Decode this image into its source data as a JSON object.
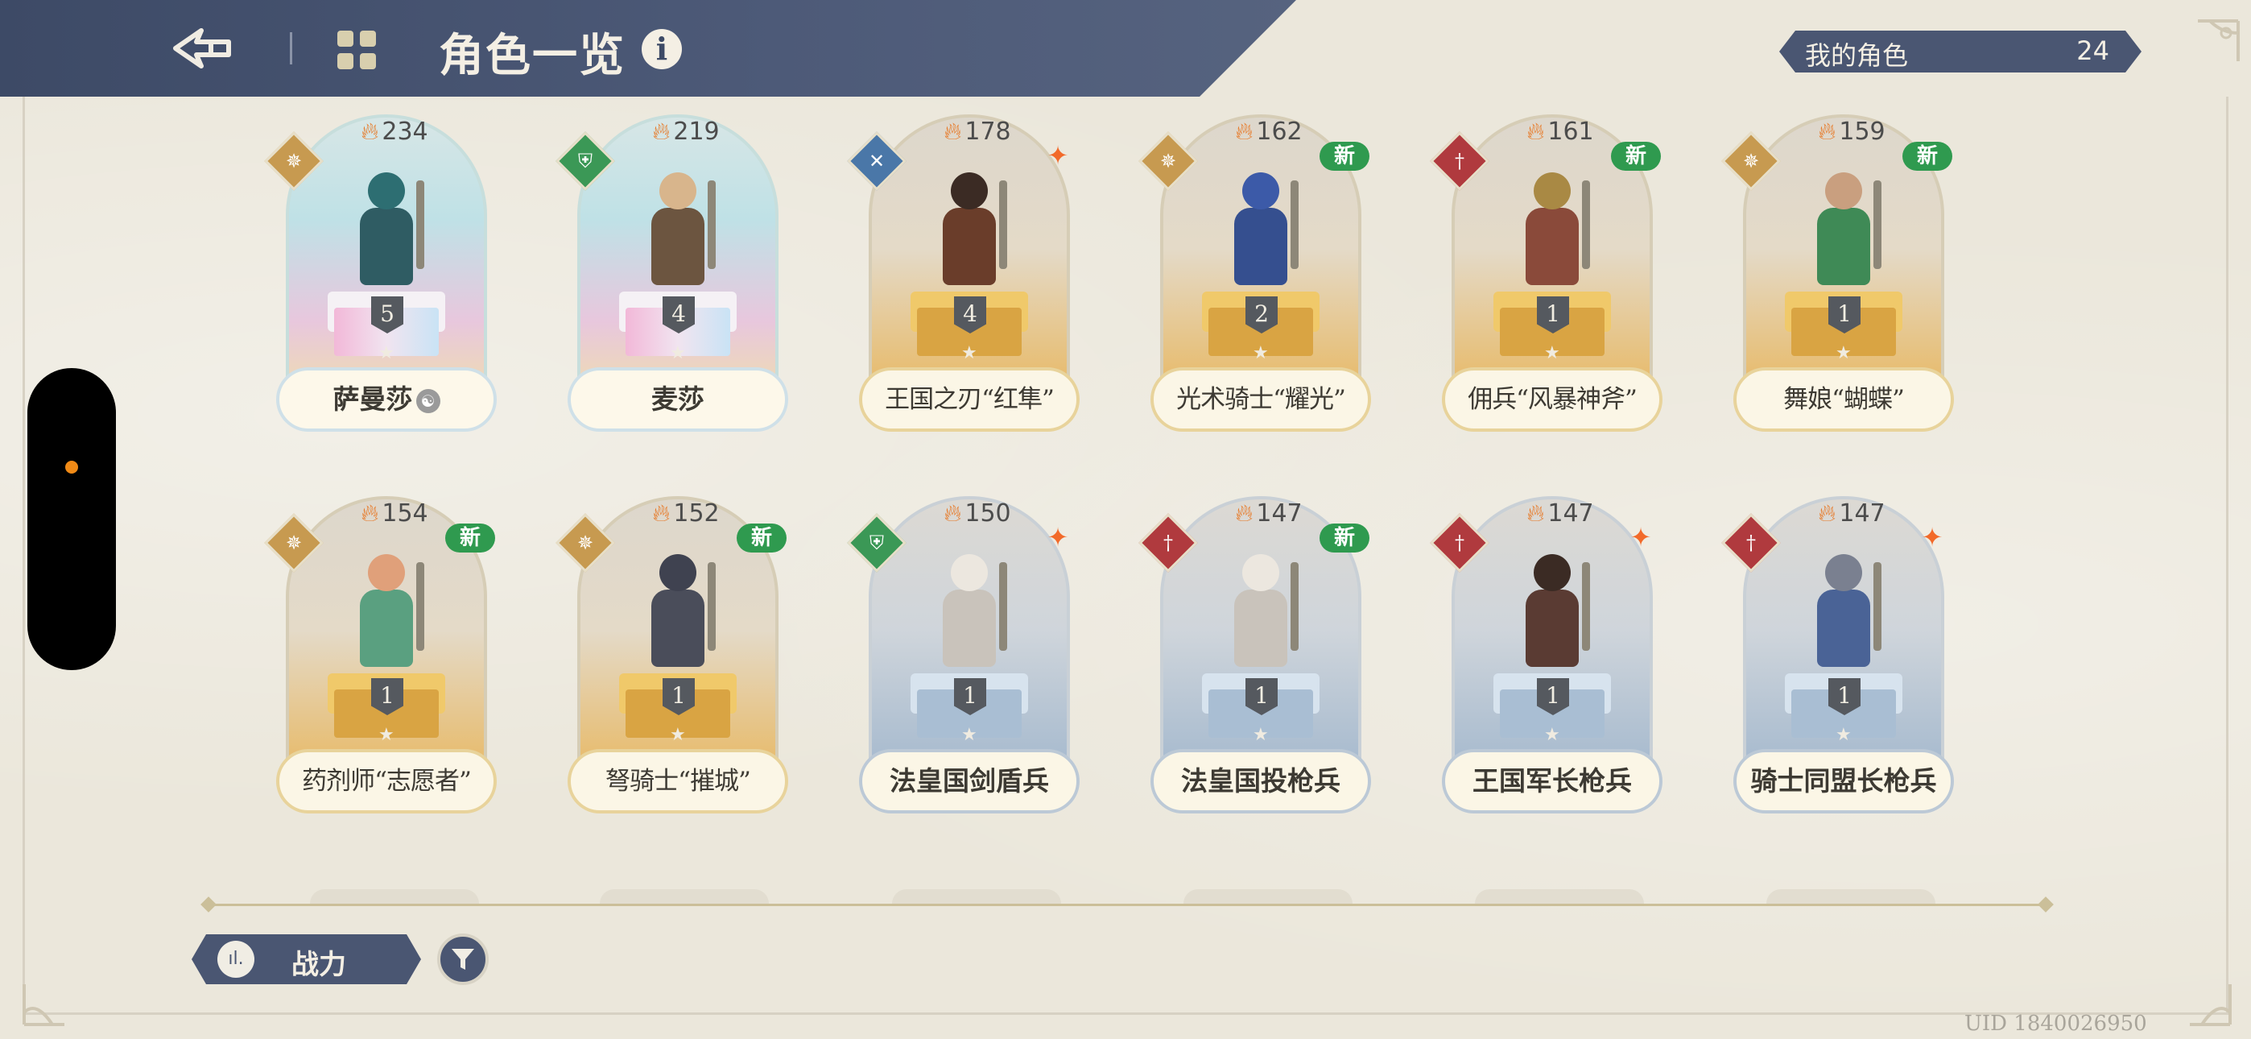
{
  "header": {
    "title": "角色一览",
    "back_icon": "trident-arrow-icon",
    "home_icon": "grid-icon",
    "info_label": "i"
  },
  "owned": {
    "label": "我的角色",
    "count": "24"
  },
  "characters": [
    {
      "power": "234",
      "name": "萨曼莎",
      "element": "gold",
      "frame": "rainbow",
      "level": "5",
      "badge": "",
      "name_icon": "☯"
    },
    {
      "power": "219",
      "name": "麦莎",
      "element": "green",
      "frame": "rainbow",
      "level": "4",
      "badge": ""
    },
    {
      "power": "178",
      "name": "王国之刃“红隼”",
      "element": "blue",
      "frame": "gold",
      "level": "4",
      "badge": "spark"
    },
    {
      "power": "162",
      "name": "光术骑士“耀光”",
      "element": "gold",
      "frame": "gold",
      "level": "2",
      "badge": "new"
    },
    {
      "power": "161",
      "name": "佣兵“风暴神斧”",
      "element": "red",
      "frame": "gold",
      "level": "1",
      "badge": "new"
    },
    {
      "power": "159",
      "name": "舞娘“蝴蝶”",
      "element": "gold",
      "frame": "gold",
      "level": "1",
      "badge": "new"
    },
    {
      "power": "154",
      "name": "药剂师“志愿者”",
      "element": "gold",
      "frame": "gold",
      "level": "1",
      "badge": "new"
    },
    {
      "power": "152",
      "name": "弩骑士“摧城”",
      "element": "gold",
      "frame": "gold",
      "level": "1",
      "badge": "new"
    },
    {
      "power": "150",
      "name": "法皇国剑盾兵",
      "element": "green",
      "frame": "blue",
      "level": "1",
      "badge": "spark"
    },
    {
      "power": "147",
      "name": "法皇国投枪兵",
      "element": "red",
      "frame": "blue",
      "level": "1",
      "badge": "new"
    },
    {
      "power": "147",
      "name": "王国军长枪兵",
      "element": "red",
      "frame": "blue",
      "level": "1",
      "badge": "spark"
    },
    {
      "power": "147",
      "name": "骑士同盟长枪兵",
      "element": "red",
      "frame": "blue",
      "level": "1",
      "badge": "spark"
    }
  ],
  "new_label": "新",
  "sort": {
    "label": "战力",
    "icon": "bar-chart-icon"
  },
  "filter": {
    "icon": "filter-icon"
  },
  "uid": "UID 1840026950",
  "colors": {
    "header": "#3d4a66",
    "accent": "#f08a16",
    "new_badge": "#2f9a4f"
  }
}
